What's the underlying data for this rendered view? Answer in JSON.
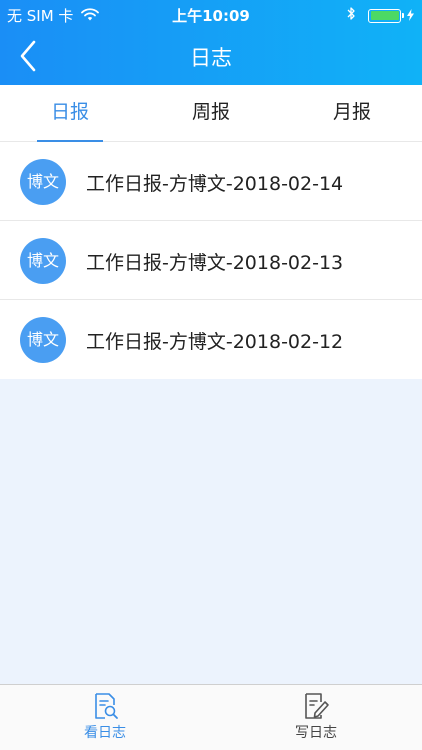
{
  "status_bar": {
    "carrier": "无 SIM 卡",
    "time": "上午10:09",
    "battery_level": 1.0
  },
  "navbar": {
    "title": "日志",
    "back_icon": "chevron-left-icon"
  },
  "tabs": [
    {
      "label": "日报",
      "active": true
    },
    {
      "label": "周报",
      "active": false
    },
    {
      "label": "月报",
      "active": false
    }
  ],
  "list": [
    {
      "avatar_text": "博文",
      "title": "工作日报-方博文-2018-02-14"
    },
    {
      "avatar_text": "博文",
      "title": "工作日报-方博文-2018-02-13"
    },
    {
      "avatar_text": "博文",
      "title": "工作日报-方博文-2018-02-12"
    }
  ],
  "tabbar": [
    {
      "label": "看日志",
      "icon": "view-log-icon",
      "active": true
    },
    {
      "label": "写日志",
      "icon": "write-log-icon",
      "active": false
    }
  ],
  "colors": {
    "header_start": "#1a8ef6",
    "header_end": "#10b2f7",
    "accent": "#3a8ee6",
    "avatar": "#4a9ef2",
    "page_background": "#ecf3fd",
    "battery": "#4cd964"
  }
}
